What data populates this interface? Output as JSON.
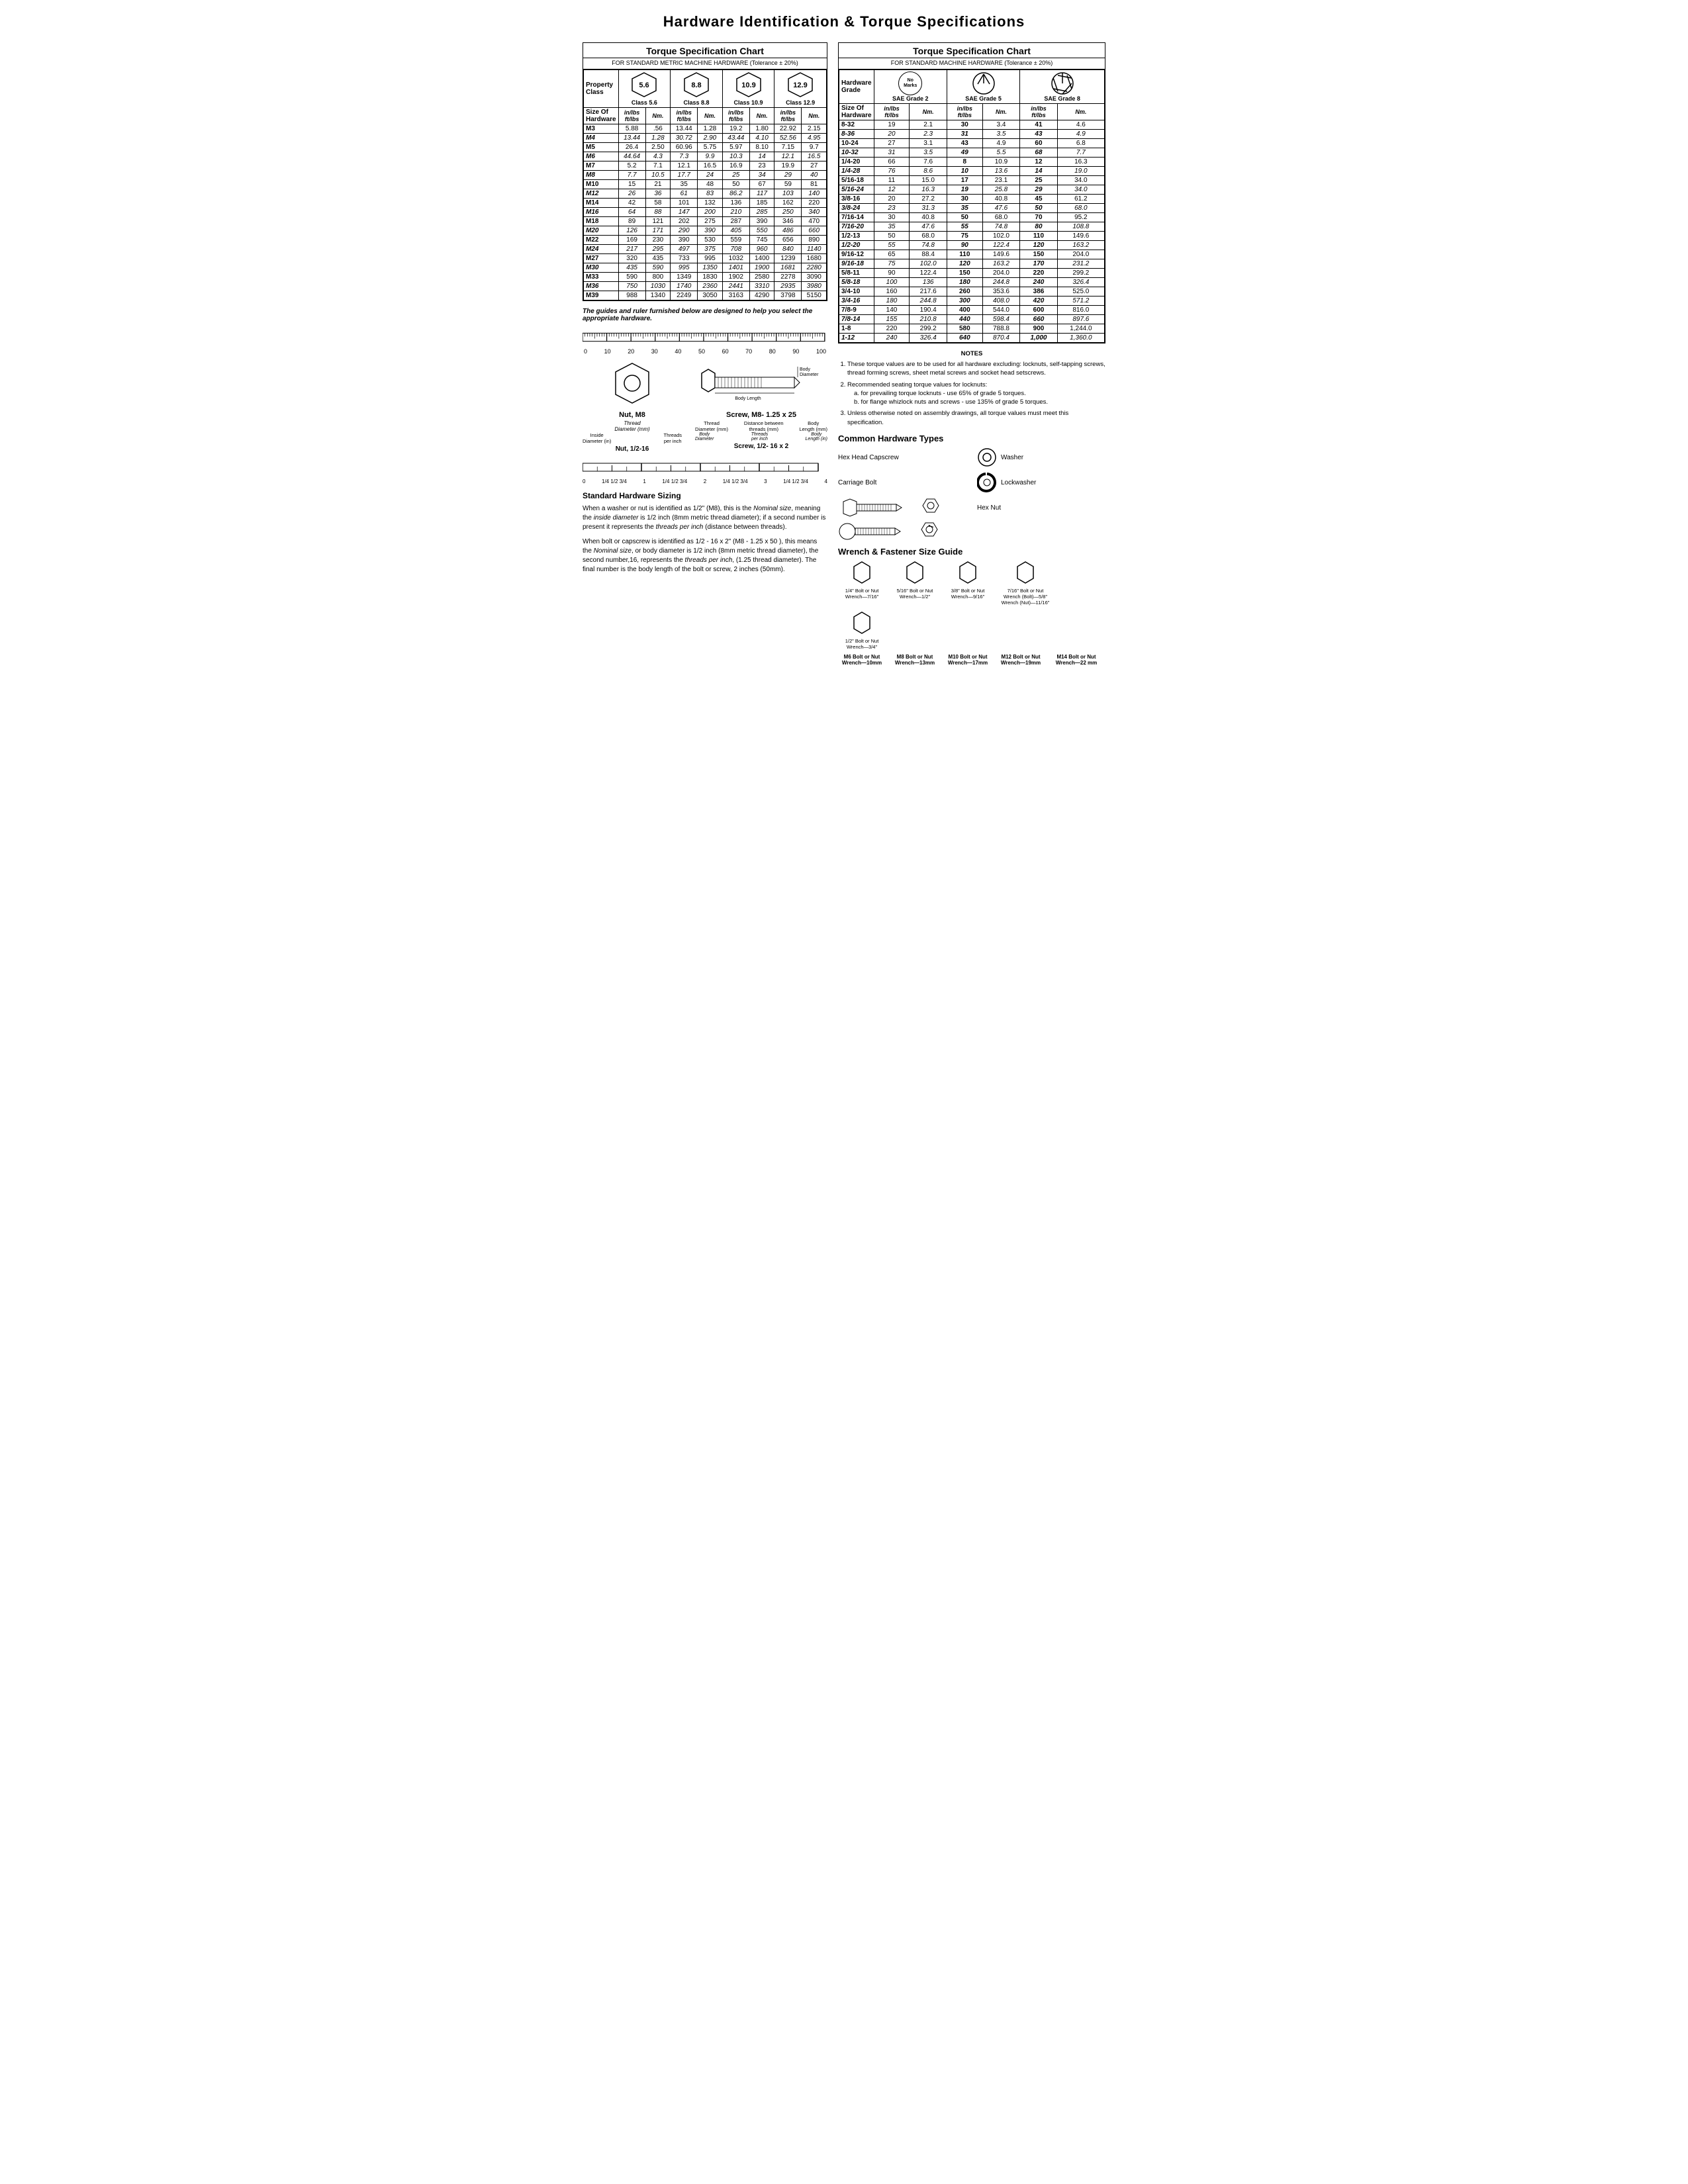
{
  "title": "Hardware Identification  &  Torque Specifications",
  "left_chart": {
    "title": "Torque Specification Chart",
    "subtitle": "FOR STANDARD METRIC MACHINE HARDWARE (Tolerance ± 20%)",
    "property_class_label": "Property\nClass",
    "classes": [
      {
        "value": "5.6",
        "label": "Class 5.6"
      },
      {
        "value": "8.8",
        "label": "Class 8.8"
      },
      {
        "value": "10.9",
        "label": "Class 10.9"
      },
      {
        "value": "12.9",
        "label": "Class 12.9"
      }
    ],
    "col_headers": [
      "in/lbs\nft/lbs",
      "Nm.",
      "in/lbs\nft/lbs",
      "Nm.",
      "in/lbs\nft/lbs",
      "Nm.",
      "in/lbs\nft/lbs",
      "Nm."
    ],
    "size_label": "Size Of\nHardware",
    "rows": [
      [
        "M3",
        "5.88",
        ".56",
        "13.44",
        "1.28",
        "19.2",
        "1.80",
        "22.92",
        "2.15"
      ],
      [
        "M4",
        "13.44",
        "1.28",
        "30.72",
        "2.90",
        "43.44",
        "4.10",
        "52.56",
        "4.95"
      ],
      [
        "M5",
        "26.4",
        "2.50",
        "60.96",
        "5.75",
        "5.97",
        "8.10",
        "7.15",
        "9.7"
      ],
      [
        "M6",
        "44.64",
        "4.3",
        "7.3",
        "9.9",
        "10.3",
        "14",
        "12.1",
        "16.5"
      ],
      [
        "M7",
        "5.2",
        "7.1",
        "12.1",
        "16.5",
        "16.9",
        "23",
        "19.9",
        "27"
      ],
      [
        "M8",
        "7.7",
        "10.5",
        "17.7",
        "24",
        "25",
        "34",
        "29",
        "40"
      ],
      [
        "M10",
        "15",
        "21",
        "35",
        "48",
        "50",
        "67",
        "59",
        "81"
      ],
      [
        "M12",
        "26",
        "36",
        "61",
        "83",
        "86.2",
        "117",
        "103",
        "140"
      ],
      [
        "M14",
        "42",
        "58",
        "101",
        "132",
        "136",
        "185",
        "162",
        "220"
      ],
      [
        "M16",
        "64",
        "88",
        "147",
        "200",
        "210",
        "285",
        "250",
        "340"
      ],
      [
        "M18",
        "89",
        "121",
        "202",
        "275",
        "287",
        "390",
        "346",
        "470"
      ],
      [
        "M20",
        "126",
        "171",
        "290",
        "390",
        "405",
        "550",
        "486",
        "660"
      ],
      [
        "M22",
        "169",
        "230",
        "390",
        "530",
        "559",
        "745",
        "656",
        "890"
      ],
      [
        "M24",
        "217",
        "295",
        "497",
        "375",
        "708",
        "960",
        "840",
        "1140"
      ],
      [
        "M27",
        "320",
        "435",
        "733",
        "995",
        "1032",
        "1400",
        "1239",
        "1680"
      ],
      [
        "M30",
        "435",
        "590",
        "995",
        "1350",
        "1401",
        "1900",
        "1681",
        "2280"
      ],
      [
        "M33",
        "590",
        "800",
        "1349",
        "1830",
        "1902",
        "2580",
        "2278",
        "3090"
      ],
      [
        "M36",
        "750",
        "1030",
        "1740",
        "2360",
        "2441",
        "3310",
        "2935",
        "3980"
      ],
      [
        "M39",
        "988",
        "1340",
        "2249",
        "3050",
        "3163",
        "4290",
        "3798",
        "5150"
      ]
    ]
  },
  "ruler_note": "The guides and ruler furnished below are designed to help you select the appropriate hardware.",
  "ruler_numbers_mm": [
    "0",
    "10",
    "20",
    "30",
    "40",
    "50",
    "60",
    "70",
    "80",
    "90",
    "100"
  ],
  "nut_label": "Nut, M8",
  "nut_sublabels": {
    "thread": "Thread",
    "diameter_mm": "Diameter (mm)",
    "inside_diameter": "Inside\nDiameter (in)",
    "threads_per_inch": "Threads\nper inch",
    "bottom_label": "Nut, 1/2-16"
  },
  "screw_label": "Screw, M8- 1.25 x 25",
  "screw_sublabels": {
    "thread": "Thread\nDiameter (mm)",
    "distance": "Distance between\nthreads (mm)",
    "body": "Body\nLength (mm)",
    "body_diameter": "Body\nDiameter",
    "threads_per_inch": "Threads\nper inch",
    "body_length_in": "Body\nLength (in)",
    "bottom_label": "Screw, 1/2- 16 x 2"
  },
  "ruler2_numbers_in": [
    "0",
    "1/4",
    "1/2",
    "3/4",
    "1",
    "1/4",
    "1/2",
    "3/4",
    "2",
    "1/4",
    "1/2",
    "3/4",
    "3",
    "1/4",
    "1/2",
    "3/4",
    "4"
  ],
  "sizing_section": {
    "title": "Standard Hardware Sizing",
    "para1": "When a washer or nut is identified as 1/2\" (M8), this is the Nominal size, meaning the inside diameter is 1/2 inch (8mm metric thread diameter); if a second number is present it represents the threads per inch (distance between threads).",
    "para2": "When bolt or capscrew is identified as 1/2 - 16 x 2\" (M8 - 1.25 x 50 ), this means the Nominal size, or body diameter is 1/2 inch (8mm metric thread diameter), the second number,16, represents the threads per inch, (1.25 thread diameter). The final number is the body length of the bolt or screw, 2 inches (50mm)."
  },
  "right_chart": {
    "title": "Torque Specification Chart",
    "subtitle": "FOR STANDARD MACHINE HARDWARE (Tolerance ± 20%)",
    "hardware_grade_label": "Hardware\nGrade",
    "grades": [
      {
        "label": "No\nMarks",
        "sublabel": "SAE Grade 2"
      },
      {
        "label": "SAE Grade 5"
      },
      {
        "label": "SAE Grade 8"
      }
    ],
    "col_headers": [
      "in/lbs\nft/lbs",
      "Nm.",
      "in/lbs\nft/lbs",
      "Nm.",
      "in/lbs\nft/lbs",
      "Nm."
    ],
    "size_label": "Size Of\nHardware",
    "rows": [
      [
        "8-32",
        "19",
        "2.1",
        "30",
        "3.4",
        "41",
        "4.6"
      ],
      [
        "8-36",
        "20",
        "2.3",
        "31",
        "3.5",
        "43",
        "4.9"
      ],
      [
        "10-24",
        "27",
        "3.1",
        "43",
        "4.9",
        "60",
        "6.8"
      ],
      [
        "10-32",
        "31",
        "3.5",
        "49",
        "5.5",
        "68",
        "7.7"
      ],
      [
        "1/4-20",
        "66",
        "7.6",
        "8",
        "10.9",
        "12",
        "16.3"
      ],
      [
        "1/4-28",
        "76",
        "8.6",
        "10",
        "13.6",
        "14",
        "19.0"
      ],
      [
        "5/16-18",
        "11",
        "15.0",
        "17",
        "23.1",
        "25",
        "34.0"
      ],
      [
        "5/16-24",
        "12",
        "16.3",
        "19",
        "25.8",
        "29",
        "34.0"
      ],
      [
        "3/8-16",
        "20",
        "27.2",
        "30",
        "40.8",
        "45",
        "61.2"
      ],
      [
        "3/8-24",
        "23",
        "31.3",
        "35",
        "47.6",
        "50",
        "68.0"
      ],
      [
        "7/16-14",
        "30",
        "40.8",
        "50",
        "68.0",
        "70",
        "95.2"
      ],
      [
        "7/16-20",
        "35",
        "47.6",
        "55",
        "74.8",
        "80",
        "108.8"
      ],
      [
        "1/2-13",
        "50",
        "68.0",
        "75",
        "102.0",
        "110",
        "149.6"
      ],
      [
        "1/2-20",
        "55",
        "74.8",
        "90",
        "122.4",
        "120",
        "163.2"
      ],
      [
        "9/16-12",
        "65",
        "88.4",
        "110",
        "149.6",
        "150",
        "204.0"
      ],
      [
        "9/16-18",
        "75",
        "102.0",
        "120",
        "163.2",
        "170",
        "231.2"
      ],
      [
        "5/8-11",
        "90",
        "122.4",
        "150",
        "204.0",
        "220",
        "299.2"
      ],
      [
        "5/8-18",
        "100",
        "136",
        "180",
        "244.8",
        "240",
        "326.4"
      ],
      [
        "3/4-10",
        "160",
        "217.6",
        "260",
        "353.6",
        "386",
        "525.0"
      ],
      [
        "3/4-16",
        "180",
        "244.8",
        "300",
        "408.0",
        "420",
        "571.2"
      ],
      [
        "7/8-9",
        "140",
        "190.4",
        "400",
        "544.0",
        "600",
        "816.0"
      ],
      [
        "7/8-14",
        "155",
        "210.8",
        "440",
        "598.4",
        "660",
        "897.6"
      ],
      [
        "1-8",
        "220",
        "299.2",
        "580",
        "788.8",
        "900",
        "1,244.0"
      ],
      [
        "1-12",
        "240",
        "326.4",
        "640",
        "870.4",
        "1,000",
        "1,360.0"
      ]
    ]
  },
  "notes": {
    "title": "NOTES",
    "items": [
      "These torque values are to be used for all hardware excluding: locknuts, self-tapping screws, thread forming screws, sheet metal screws and socket head setscrews.",
      "Recommended seating torque values for locknuts:\n  a. for prevailing torque locknuts - use 65% of grade 5 torques.\n  b. for flange whizlock nuts and screws - use 135% of grade 5 torques.",
      "Unless otherwise noted on assembly drawings, all torque values must meet this specification."
    ]
  },
  "common_hw": {
    "title": "Common Hardware Types",
    "items": [
      {
        "label": "Hex Head Capscrew",
        "type": "hex-capscrew"
      },
      {
        "label": "Washer",
        "type": "washer"
      },
      {
        "label": "Carriage Bolt",
        "type": "carriage-bolt"
      },
      {
        "label": "Lockwasher",
        "type": "lockwasher"
      },
      {
        "label": "",
        "type": ""
      },
      {
        "label": "Hex Nut",
        "type": "hex-nut"
      }
    ]
  },
  "wrench_guide": {
    "title": "Wrench & Fastener Size Guide",
    "items": [
      {
        "label": "1/4\" Bolt or Nut\nWrench—7/16\""
      },
      {
        "label": "5/16\" Bolt or Nut\nWrench—1/2\""
      },
      {
        "label": "3/8\" Bolt or Nut\nWrench—9/16\""
      },
      {
        "label": "7/16\" Bolt or Nut\nWrench (Bolt)—5/8\"\nWrench (Nut)—11/16\""
      },
      {
        "label": "1/2\" Bolt or Nut\nWrench—3/4\""
      },
      {
        "label": "M6 Bolt or Nut\nWrench—10mm"
      },
      {
        "label": "M8 Bolt or Nut\nWrench—13mm"
      },
      {
        "label": "M10 Bolt or Nut\nWrench—17mm"
      },
      {
        "label": "M12 Bolt or Nut\nWrench—19mm"
      },
      {
        "label": "M14 Bolt or Nut\nWrench—22 mm"
      }
    ]
  }
}
